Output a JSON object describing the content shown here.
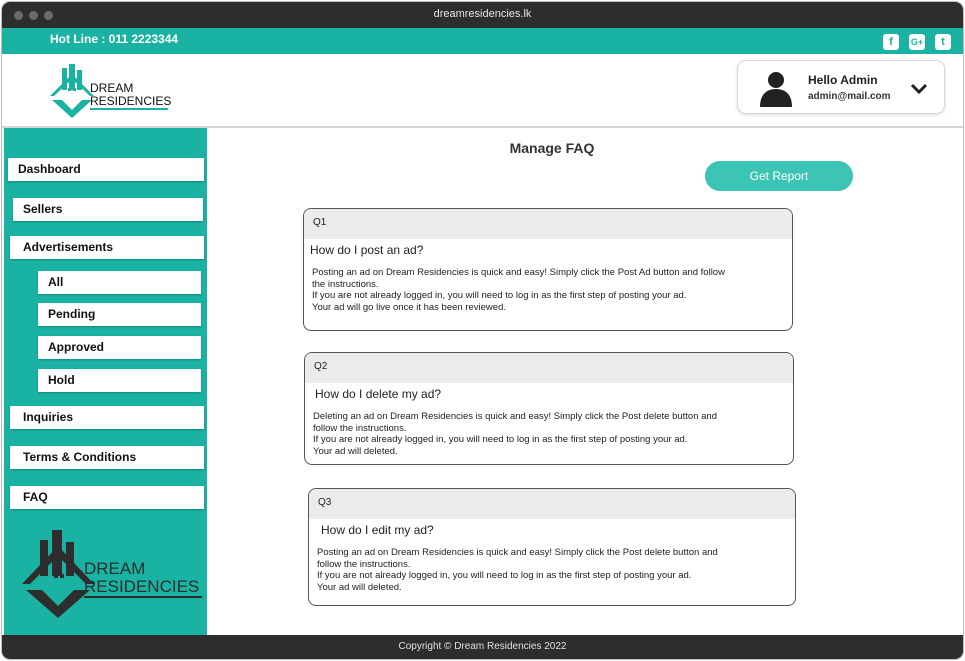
{
  "browser": {
    "url": "dreamresidencies.lk"
  },
  "topbar": {
    "hotline": "Hot Line : 011 2223344",
    "social": [
      {
        "icon": "facebook-icon",
        "glyph": "f"
      },
      {
        "icon": "google-plus-icon",
        "glyph": "G+"
      },
      {
        "icon": "twitter-icon",
        "glyph": "t"
      }
    ]
  },
  "brand": {
    "line1": "DREAM",
    "line2": "RESIDENCIES",
    "color": "#1ab3a3"
  },
  "admin": {
    "greeting": "Hello Admin",
    "email": "admin@mail.com"
  },
  "sidebar": {
    "items": [
      {
        "label": "Dashboard"
      },
      {
        "label": "Sellers"
      },
      {
        "label": "Advertisements"
      },
      {
        "label": "All"
      },
      {
        "label": "Pending"
      },
      {
        "label": "Approved"
      },
      {
        "label": "Hold"
      },
      {
        "label": "Inquiries"
      },
      {
        "label": "Terms & Conditions"
      },
      {
        "label": "FAQ"
      }
    ]
  },
  "main": {
    "title": "Manage FAQ",
    "report_button": "Get Report",
    "faqs": [
      {
        "number": "Q1",
        "question": "How do I post an ad?",
        "answer_lines": [
          "Posting an ad on Dream Residencies is quick and easy! Simply click the Post Ad button and follow",
          "the instructions.",
          "If you are not already logged in, you will need to log in as the first step of posting your ad.",
          "Your ad will go live once it has been reviewed."
        ]
      },
      {
        "number": "Q2",
        "question": "How do I delete my ad?",
        "answer_lines": [
          "Deleting an ad on Dream Residencies is quick and easy! Simply click the Post delete button and",
          "follow the instructions.",
          "If you are not already logged in, you will need to log in as the first step of posting your ad.",
          "Your ad will deleted."
        ]
      },
      {
        "number": "Q3",
        "question": "How do I edit my ad?",
        "answer_lines": [
          "Posting an ad on Dream Residencies is quick and easy! Simply click the Post delete button and",
          "follow the instructions.",
          "If you are not already logged in, you will need to log in as the first step of posting your ad.",
          "Your ad will deleted."
        ]
      }
    ]
  },
  "footer": {
    "copyright": "Copyright © Dream Residencies 2022"
  },
  "colors": {
    "accent": "#1ab3a3",
    "button": "#3cc4b4",
    "dark": "#2d2d2d"
  }
}
